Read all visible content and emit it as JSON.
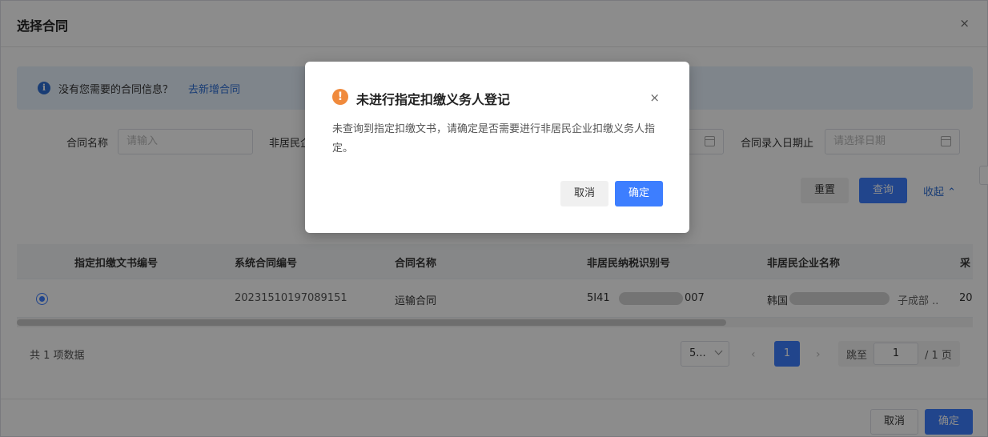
{
  "header": {
    "title": "选择合同",
    "close": "×"
  },
  "info": {
    "text": "没有您需要的合同信息？",
    "link": "去新增合同",
    "icon": "info-icon"
  },
  "filters": {
    "contract_name_label": "合同名称",
    "contract_name_placeholder": "请输入",
    "nonresident_label": "非居民企",
    "entry_date_label": "合同录入日期止",
    "entry_date_placeholder": "请选择日期"
  },
  "actions": {
    "reset": "重置",
    "query": "查询",
    "collapse": "收起 ⌃"
  },
  "table": {
    "headers": [
      "指定扣缴文书编号",
      "系统合同编号",
      "合同名称",
      "非居民纳税识别号",
      "非居民企业名称",
      "采"
    ],
    "rows": [
      {
        "doc_no": "",
        "sys_no": "20231510197089151",
        "name": "运输合同",
        "tax_id_prefix": "5I41",
        "tax_id_suffix": "007",
        "company_prefix": "韩国",
        "company_suffix": "子成部 ..",
        "last": "20"
      }
    ]
  },
  "pagination": {
    "total": "共 1 项数据",
    "page_size": "5...",
    "prev": "‹",
    "current": "1",
    "next": "›",
    "jump_label": "跳至",
    "jump_value": "1",
    "jump_suffix": "/ 1 页"
  },
  "footer": {
    "cancel": "取消",
    "ok": "确定"
  },
  "modal": {
    "icon": "warning-icon",
    "title": "未进行指定扣缴义务人登记",
    "body": "未查询到指定扣缴文书，请确定是否需要进行非居民企业扣缴义务人指定。",
    "close": "×",
    "cancel": "取消",
    "ok": "确定"
  },
  "colors": {
    "primary": "#3d7eff",
    "link": "#2f6fd6",
    "warning": "#f08a3c",
    "info_bg": "#e8f2fd"
  }
}
